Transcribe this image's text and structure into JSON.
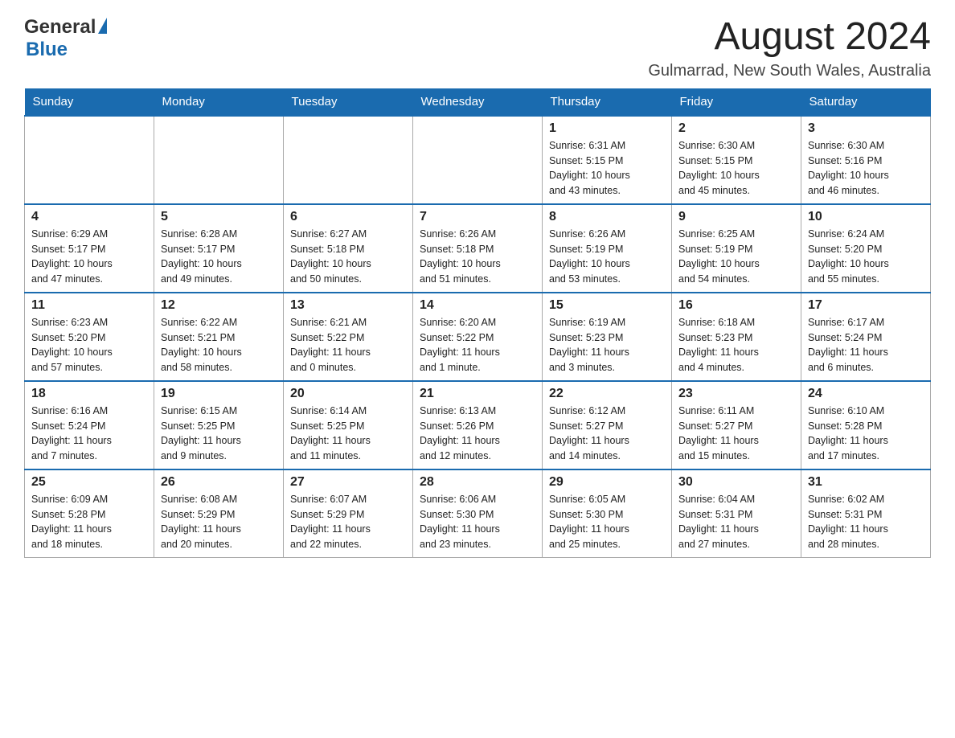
{
  "header": {
    "logo_general": "General",
    "logo_blue": "Blue",
    "month_year": "August 2024",
    "location": "Gulmarrad, New South Wales, Australia"
  },
  "weekdays": [
    "Sunday",
    "Monday",
    "Tuesday",
    "Wednesday",
    "Thursday",
    "Friday",
    "Saturday"
  ],
  "weeks": [
    [
      {
        "day": "",
        "info": ""
      },
      {
        "day": "",
        "info": ""
      },
      {
        "day": "",
        "info": ""
      },
      {
        "day": "",
        "info": ""
      },
      {
        "day": "1",
        "info": "Sunrise: 6:31 AM\nSunset: 5:15 PM\nDaylight: 10 hours\nand 43 minutes."
      },
      {
        "day": "2",
        "info": "Sunrise: 6:30 AM\nSunset: 5:15 PM\nDaylight: 10 hours\nand 45 minutes."
      },
      {
        "day": "3",
        "info": "Sunrise: 6:30 AM\nSunset: 5:16 PM\nDaylight: 10 hours\nand 46 minutes."
      }
    ],
    [
      {
        "day": "4",
        "info": "Sunrise: 6:29 AM\nSunset: 5:17 PM\nDaylight: 10 hours\nand 47 minutes."
      },
      {
        "day": "5",
        "info": "Sunrise: 6:28 AM\nSunset: 5:17 PM\nDaylight: 10 hours\nand 49 minutes."
      },
      {
        "day": "6",
        "info": "Sunrise: 6:27 AM\nSunset: 5:18 PM\nDaylight: 10 hours\nand 50 minutes."
      },
      {
        "day": "7",
        "info": "Sunrise: 6:26 AM\nSunset: 5:18 PM\nDaylight: 10 hours\nand 51 minutes."
      },
      {
        "day": "8",
        "info": "Sunrise: 6:26 AM\nSunset: 5:19 PM\nDaylight: 10 hours\nand 53 minutes."
      },
      {
        "day": "9",
        "info": "Sunrise: 6:25 AM\nSunset: 5:19 PM\nDaylight: 10 hours\nand 54 minutes."
      },
      {
        "day": "10",
        "info": "Sunrise: 6:24 AM\nSunset: 5:20 PM\nDaylight: 10 hours\nand 55 minutes."
      }
    ],
    [
      {
        "day": "11",
        "info": "Sunrise: 6:23 AM\nSunset: 5:20 PM\nDaylight: 10 hours\nand 57 minutes."
      },
      {
        "day": "12",
        "info": "Sunrise: 6:22 AM\nSunset: 5:21 PM\nDaylight: 10 hours\nand 58 minutes."
      },
      {
        "day": "13",
        "info": "Sunrise: 6:21 AM\nSunset: 5:22 PM\nDaylight: 11 hours\nand 0 minutes."
      },
      {
        "day": "14",
        "info": "Sunrise: 6:20 AM\nSunset: 5:22 PM\nDaylight: 11 hours\nand 1 minute."
      },
      {
        "day": "15",
        "info": "Sunrise: 6:19 AM\nSunset: 5:23 PM\nDaylight: 11 hours\nand 3 minutes."
      },
      {
        "day": "16",
        "info": "Sunrise: 6:18 AM\nSunset: 5:23 PM\nDaylight: 11 hours\nand 4 minutes."
      },
      {
        "day": "17",
        "info": "Sunrise: 6:17 AM\nSunset: 5:24 PM\nDaylight: 11 hours\nand 6 minutes."
      }
    ],
    [
      {
        "day": "18",
        "info": "Sunrise: 6:16 AM\nSunset: 5:24 PM\nDaylight: 11 hours\nand 7 minutes."
      },
      {
        "day": "19",
        "info": "Sunrise: 6:15 AM\nSunset: 5:25 PM\nDaylight: 11 hours\nand 9 minutes."
      },
      {
        "day": "20",
        "info": "Sunrise: 6:14 AM\nSunset: 5:25 PM\nDaylight: 11 hours\nand 11 minutes."
      },
      {
        "day": "21",
        "info": "Sunrise: 6:13 AM\nSunset: 5:26 PM\nDaylight: 11 hours\nand 12 minutes."
      },
      {
        "day": "22",
        "info": "Sunrise: 6:12 AM\nSunset: 5:27 PM\nDaylight: 11 hours\nand 14 minutes."
      },
      {
        "day": "23",
        "info": "Sunrise: 6:11 AM\nSunset: 5:27 PM\nDaylight: 11 hours\nand 15 minutes."
      },
      {
        "day": "24",
        "info": "Sunrise: 6:10 AM\nSunset: 5:28 PM\nDaylight: 11 hours\nand 17 minutes."
      }
    ],
    [
      {
        "day": "25",
        "info": "Sunrise: 6:09 AM\nSunset: 5:28 PM\nDaylight: 11 hours\nand 18 minutes."
      },
      {
        "day": "26",
        "info": "Sunrise: 6:08 AM\nSunset: 5:29 PM\nDaylight: 11 hours\nand 20 minutes."
      },
      {
        "day": "27",
        "info": "Sunrise: 6:07 AM\nSunset: 5:29 PM\nDaylight: 11 hours\nand 22 minutes."
      },
      {
        "day": "28",
        "info": "Sunrise: 6:06 AM\nSunset: 5:30 PM\nDaylight: 11 hours\nand 23 minutes."
      },
      {
        "day": "29",
        "info": "Sunrise: 6:05 AM\nSunset: 5:30 PM\nDaylight: 11 hours\nand 25 minutes."
      },
      {
        "day": "30",
        "info": "Sunrise: 6:04 AM\nSunset: 5:31 PM\nDaylight: 11 hours\nand 27 minutes."
      },
      {
        "day": "31",
        "info": "Sunrise: 6:02 AM\nSunset: 5:31 PM\nDaylight: 11 hours\nand 28 minutes."
      }
    ]
  ]
}
